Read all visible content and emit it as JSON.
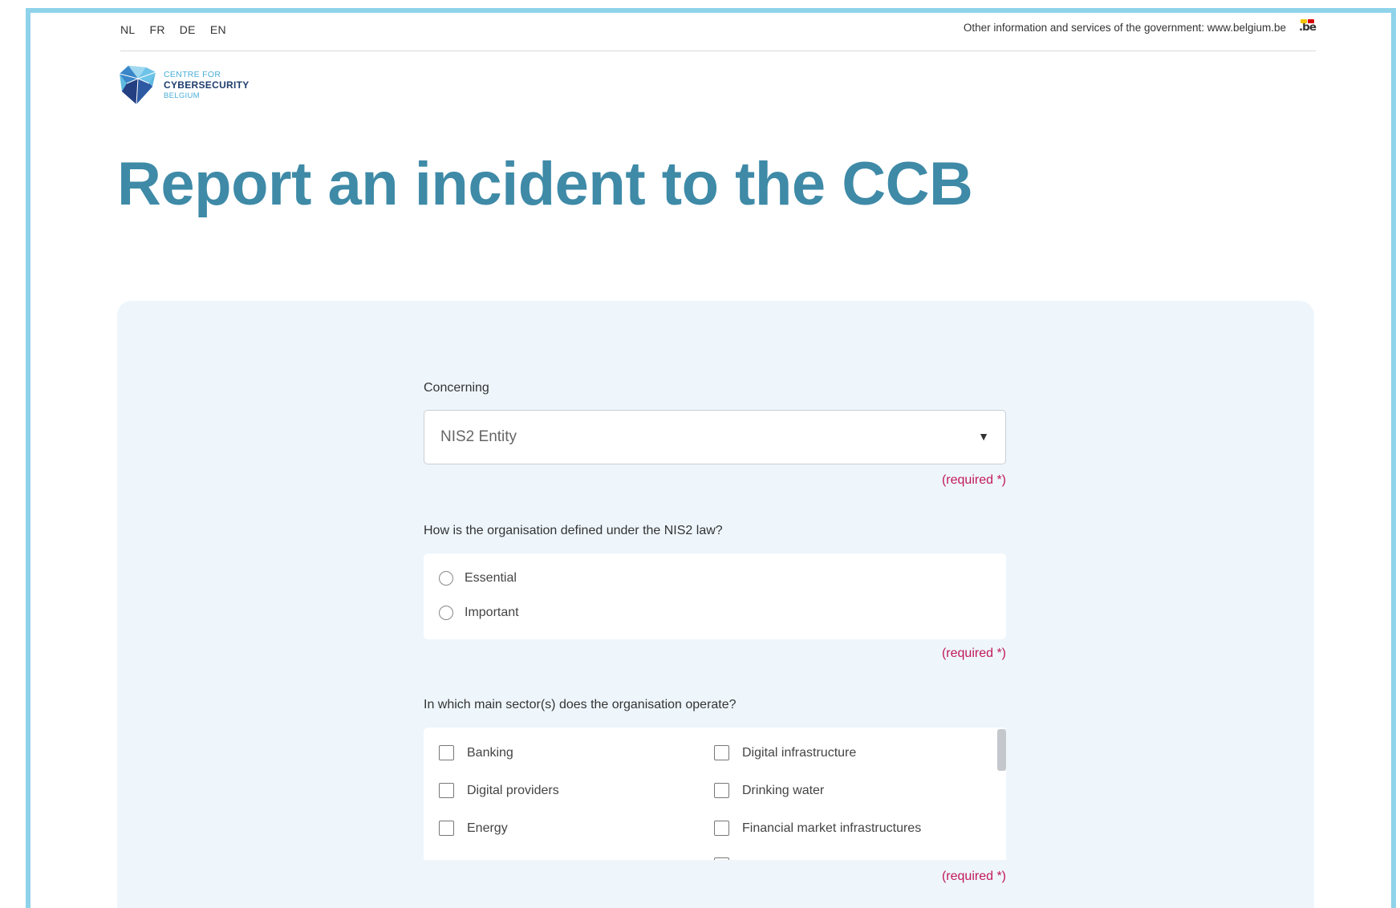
{
  "languages": [
    "NL",
    "FR",
    "DE",
    "EN"
  ],
  "gov_text": "Other information and services of the government: www.belgium.be",
  "be_logo": ".be",
  "logo": {
    "line1": "CENTRE FOR",
    "line2": "CYBERSECURITY",
    "line3": "BELGIUM"
  },
  "page_title": "Report an incident to the CCB",
  "form": {
    "concerning": {
      "label": "Concerning",
      "value": "NIS2 Entity",
      "required": "(required *)"
    },
    "definition": {
      "label": "How is the organisation defined under the NIS2 law?",
      "options": [
        "Essential",
        "Important"
      ],
      "required": "(required *)"
    },
    "sectors": {
      "label": "In which main sector(s) does the organisation operate?",
      "left": [
        "Banking",
        "Digital providers",
        "Energy"
      ],
      "right": [
        "Digital infrastructure",
        "Drinking water",
        "Financial market infrastructures"
      ],
      "required": "(required *)"
    }
  },
  "colors": {
    "frame": "#8fd3ea",
    "title": "#3e8aa7",
    "panel": "#eef6fc",
    "required": "#c2185b"
  }
}
